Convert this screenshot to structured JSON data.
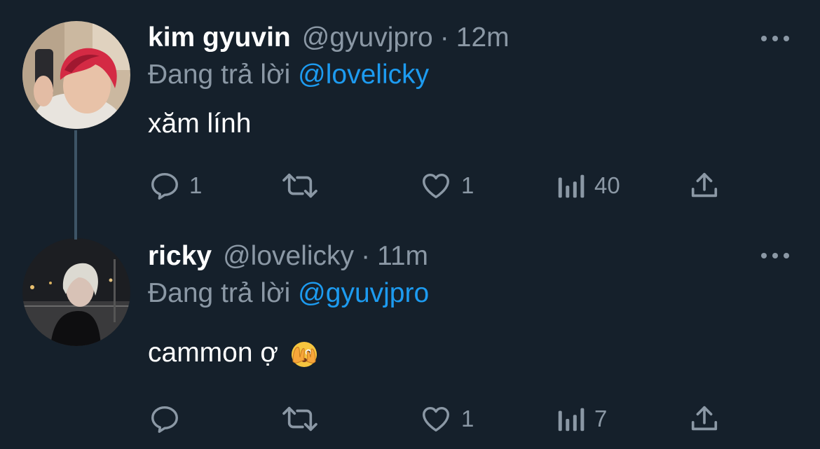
{
  "reply_prefix": "Đang trả lời",
  "tweets": [
    {
      "name": "kim gyuvin",
      "handle": "@gyuvjpro",
      "separator": "·",
      "time": "12m",
      "replying_to": "@lovelicky",
      "text": "xăm lính",
      "stats": {
        "replies": "1",
        "retweets": "",
        "likes": "1",
        "views": "40"
      }
    },
    {
      "name": "ricky",
      "handle": "@lovelicky",
      "separator": "·",
      "time": "11m",
      "replying_to": "@gyuvjpro",
      "text": "cammon ợ",
      "emoji": "face-with-peeking-eye",
      "stats": {
        "replies": "",
        "retweets": "",
        "likes": "1",
        "views": "7"
      }
    }
  ],
  "icons": {
    "reply": "reply-icon",
    "retweet": "retweet-icon",
    "like": "heart-icon",
    "views": "views-icon",
    "share": "share-icon",
    "more": "more-icon"
  },
  "colors": {
    "background": "#15202b",
    "primary_text": "#ffffff",
    "secondary_text": "#8b98a5",
    "link": "#1d9bf0",
    "thread_line": "#3d5466"
  }
}
